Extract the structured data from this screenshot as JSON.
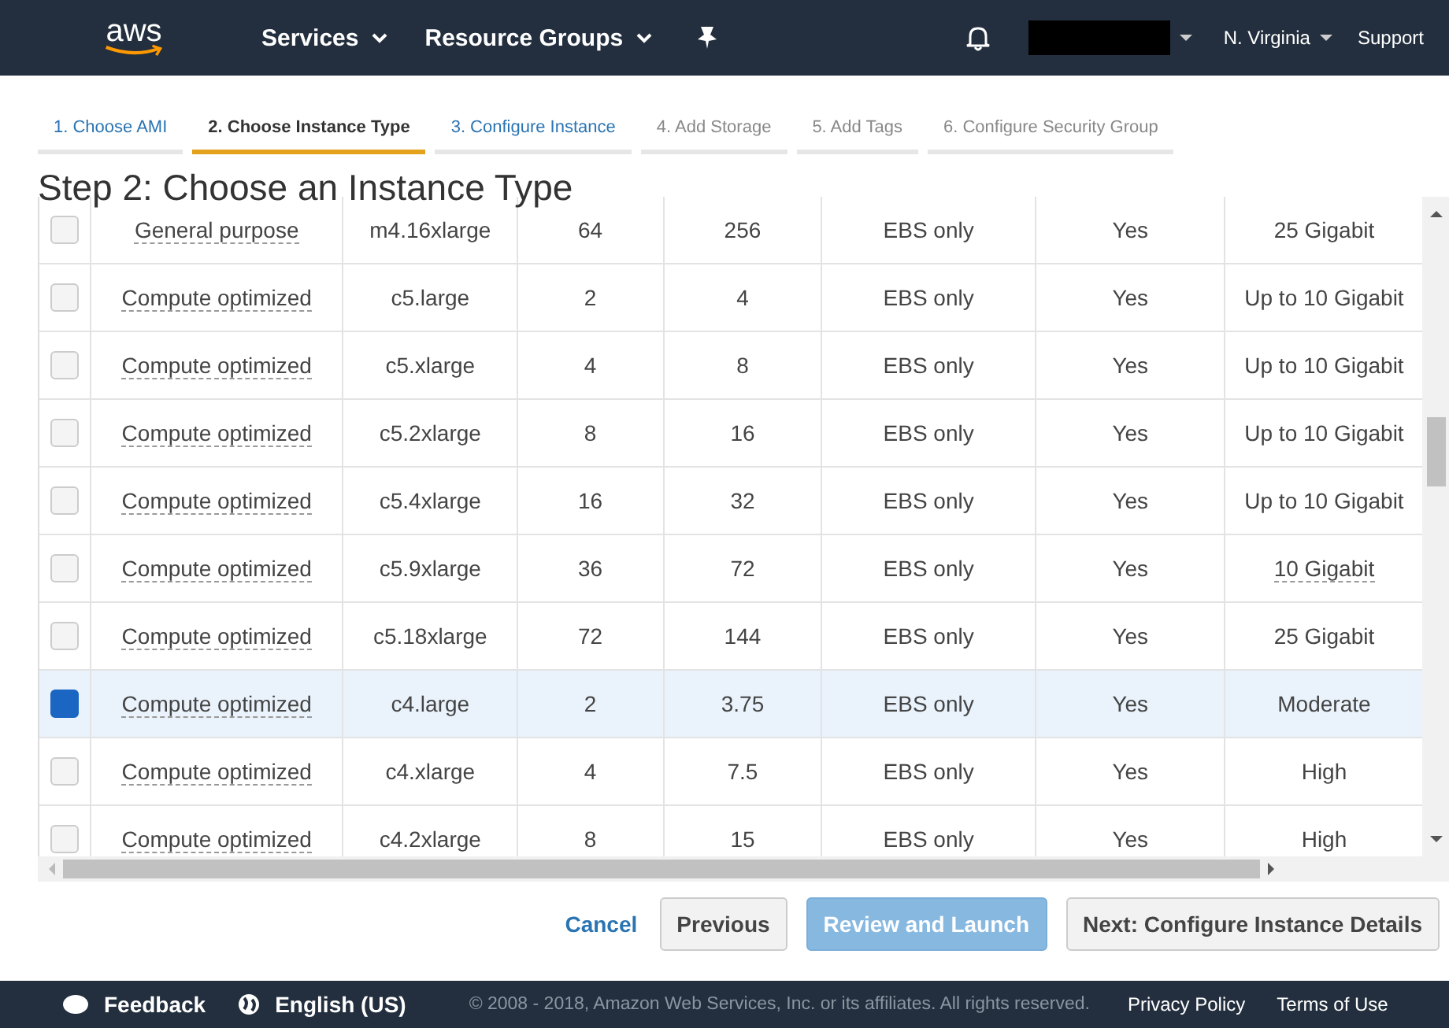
{
  "nav": {
    "logo": "aws",
    "services": "Services",
    "resource_groups": "Resource Groups",
    "region": "N. Virginia",
    "support": "Support"
  },
  "steps": [
    {
      "label": "1. Choose AMI",
      "selected": false,
      "disabled": false
    },
    {
      "label": "2. Choose Instance Type",
      "selected": true,
      "disabled": false
    },
    {
      "label": "3. Configure Instance",
      "selected": false,
      "disabled": false
    },
    {
      "label": "4. Add Storage",
      "selected": false,
      "disabled": true
    },
    {
      "label": "5. Add Tags",
      "selected": false,
      "disabled": true
    },
    {
      "label": "6. Configure Security Group",
      "selected": false,
      "disabled": true
    }
  ],
  "title": "Step 2: Choose an Instance Type",
  "rows": [
    {
      "selected": false,
      "family": "General purpose",
      "type": "m4.16xlarge",
      "vcpus": "64",
      "memory": "256",
      "storage": "EBS only",
      "ebs_optimized": "Yes",
      "network": "25 Gigabit",
      "network_hint": false
    },
    {
      "selected": false,
      "family": "Compute optimized",
      "type": "c5.large",
      "vcpus": "2",
      "memory": "4",
      "storage": "EBS only",
      "ebs_optimized": "Yes",
      "network": "Up to 10 Gigabit",
      "network_hint": false
    },
    {
      "selected": false,
      "family": "Compute optimized",
      "type": "c5.xlarge",
      "vcpus": "4",
      "memory": "8",
      "storage": "EBS only",
      "ebs_optimized": "Yes",
      "network": "Up to 10 Gigabit",
      "network_hint": false
    },
    {
      "selected": false,
      "family": "Compute optimized",
      "type": "c5.2xlarge",
      "vcpus": "8",
      "memory": "16",
      "storage": "EBS only",
      "ebs_optimized": "Yes",
      "network": "Up to 10 Gigabit",
      "network_hint": false
    },
    {
      "selected": false,
      "family": "Compute optimized",
      "type": "c5.4xlarge",
      "vcpus": "16",
      "memory": "32",
      "storage": "EBS only",
      "ebs_optimized": "Yes",
      "network": "Up to 10 Gigabit",
      "network_hint": false
    },
    {
      "selected": false,
      "family": "Compute optimized",
      "type": "c5.9xlarge",
      "vcpus": "36",
      "memory": "72",
      "storage": "EBS only",
      "ebs_optimized": "Yes",
      "network": "10 Gigabit",
      "network_hint": true
    },
    {
      "selected": false,
      "family": "Compute optimized",
      "type": "c5.18xlarge",
      "vcpus": "72",
      "memory": "144",
      "storage": "EBS only",
      "ebs_optimized": "Yes",
      "network": "25 Gigabit",
      "network_hint": false
    },
    {
      "selected": true,
      "family": "Compute optimized",
      "type": "c4.large",
      "vcpus": "2",
      "memory": "3.75",
      "storage": "EBS only",
      "ebs_optimized": "Yes",
      "network": "Moderate",
      "network_hint": false
    },
    {
      "selected": false,
      "family": "Compute optimized",
      "type": "c4.xlarge",
      "vcpus": "4",
      "memory": "7.5",
      "storage": "EBS only",
      "ebs_optimized": "Yes",
      "network": "High",
      "network_hint": false
    },
    {
      "selected": false,
      "family": "Compute optimized",
      "type": "c4.2xlarge",
      "vcpus": "8",
      "memory": "15",
      "storage": "EBS only",
      "ebs_optimized": "Yes",
      "network": "High",
      "network_hint": false
    }
  ],
  "buttons": {
    "cancel": "Cancel",
    "previous": "Previous",
    "review": "Review and Launch",
    "next": "Next: Configure Instance Details"
  },
  "footer": {
    "feedback": "Feedback",
    "language": "English (US)",
    "copyright": "© 2008 - 2018, Amazon Web Services, Inc. or its affiliates. All rights reserved.",
    "privacy": "Privacy Policy",
    "terms": "Terms of Use"
  }
}
